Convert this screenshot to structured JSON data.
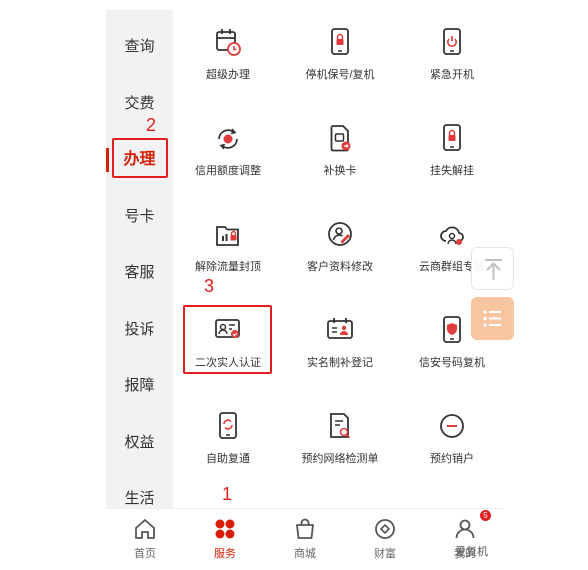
{
  "sidebar": {
    "items": [
      {
        "label": "查询"
      },
      {
        "label": "交费"
      },
      {
        "label": "办理"
      },
      {
        "label": "号卡"
      },
      {
        "label": "客服"
      },
      {
        "label": "投诉"
      },
      {
        "label": "报障"
      },
      {
        "label": "权益"
      },
      {
        "label": "生活"
      }
    ],
    "active_label": "办理"
  },
  "grid": {
    "items": [
      {
        "label": "超级办理",
        "icon": "calendar-clock-icon"
      },
      {
        "label": "停机保号/复机",
        "icon": "phone-lock-icon"
      },
      {
        "label": "紧急开机",
        "icon": "phone-power-icon"
      },
      {
        "label": "信用额度调整",
        "icon": "credit-refresh-icon"
      },
      {
        "label": "补换卡",
        "icon": "sim-card-icon"
      },
      {
        "label": "挂失解挂",
        "icon": "phone-lock-badge-icon"
      },
      {
        "label": "解除流量封顶",
        "icon": "folder-lock-icon"
      },
      {
        "label": "客户资料修改",
        "icon": "edit-circle-icon"
      },
      {
        "label": "云商群组专区",
        "icon": "cloud-person-icon"
      },
      {
        "label": "二次实人认证",
        "icon": "id-card-icon"
      },
      {
        "label": "实名制补登记",
        "icon": "id-register-icon"
      },
      {
        "label": "信安号码复机",
        "icon": "phone-shield-icon"
      },
      {
        "label": "自助复通",
        "icon": "phone-refresh-icon"
      },
      {
        "label": "预约网络检测单",
        "icon": "document-search-icon"
      },
      {
        "label": "预约销户",
        "icon": "minus-circle-icon"
      }
    ]
  },
  "steps": {
    "one": "1",
    "two": "2",
    "three": "3"
  },
  "tabbar": {
    "items": [
      {
        "label": "首页",
        "icon": "home-icon"
      },
      {
        "label": "服务",
        "icon": "service-flower-icon"
      },
      {
        "label": "商城",
        "icon": "shopping-bag-icon"
      },
      {
        "label": "财富",
        "icon": "wealth-icon"
      },
      {
        "label": "我的",
        "icon": "user-icon"
      }
    ],
    "active_label": "服务",
    "badge_count": "5"
  },
  "floating": {
    "top_icon": "arrow-up-icon",
    "list_icon": "list-icon"
  },
  "watermark": "爱复机",
  "colors": {
    "accent": "#d81e06",
    "annotation": "#e02020",
    "float_orange": "#f7c6a0"
  }
}
